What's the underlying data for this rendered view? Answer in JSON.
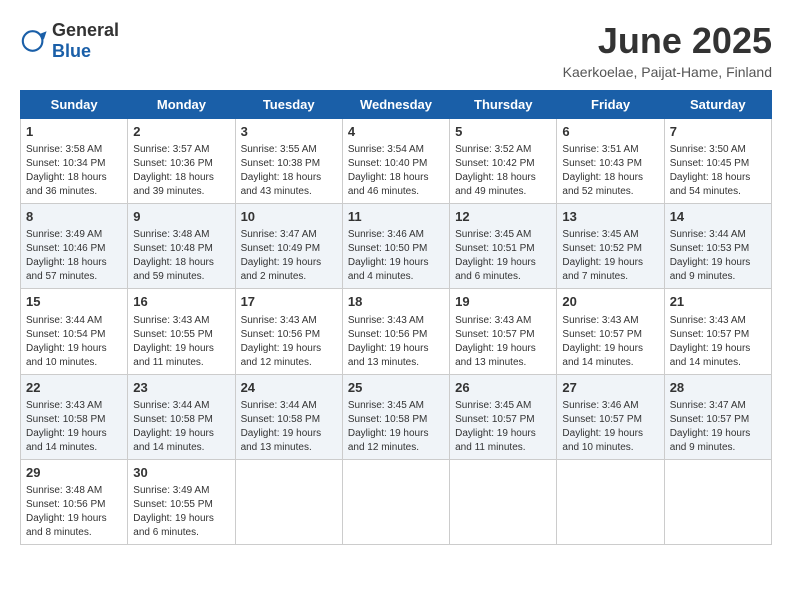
{
  "header": {
    "logo_general": "General",
    "logo_blue": "Blue",
    "month": "June 2025",
    "location": "Kaerkoelae, Paijat-Hame, Finland"
  },
  "days_of_week": [
    "Sunday",
    "Monday",
    "Tuesday",
    "Wednesday",
    "Thursday",
    "Friday",
    "Saturday"
  ],
  "weeks": [
    [
      {
        "day": "1",
        "sunrise": "3:58 AM",
        "sunset": "10:34 PM",
        "daylight": "18 hours and 36 minutes."
      },
      {
        "day": "2",
        "sunrise": "3:57 AM",
        "sunset": "10:36 PM",
        "daylight": "18 hours and 39 minutes."
      },
      {
        "day": "3",
        "sunrise": "3:55 AM",
        "sunset": "10:38 PM",
        "daylight": "18 hours and 43 minutes."
      },
      {
        "day": "4",
        "sunrise": "3:54 AM",
        "sunset": "10:40 PM",
        "daylight": "18 hours and 46 minutes."
      },
      {
        "day": "5",
        "sunrise": "3:52 AM",
        "sunset": "10:42 PM",
        "daylight": "18 hours and 49 minutes."
      },
      {
        "day": "6",
        "sunrise": "3:51 AM",
        "sunset": "10:43 PM",
        "daylight": "18 hours and 52 minutes."
      },
      {
        "day": "7",
        "sunrise": "3:50 AM",
        "sunset": "10:45 PM",
        "daylight": "18 hours and 54 minutes."
      }
    ],
    [
      {
        "day": "8",
        "sunrise": "3:49 AM",
        "sunset": "10:46 PM",
        "daylight": "18 hours and 57 minutes."
      },
      {
        "day": "9",
        "sunrise": "3:48 AM",
        "sunset": "10:48 PM",
        "daylight": "18 hours and 59 minutes."
      },
      {
        "day": "10",
        "sunrise": "3:47 AM",
        "sunset": "10:49 PM",
        "daylight": "19 hours and 2 minutes."
      },
      {
        "day": "11",
        "sunrise": "3:46 AM",
        "sunset": "10:50 PM",
        "daylight": "19 hours and 4 minutes."
      },
      {
        "day": "12",
        "sunrise": "3:45 AM",
        "sunset": "10:51 PM",
        "daylight": "19 hours and 6 minutes."
      },
      {
        "day": "13",
        "sunrise": "3:45 AM",
        "sunset": "10:52 PM",
        "daylight": "19 hours and 7 minutes."
      },
      {
        "day": "14",
        "sunrise": "3:44 AM",
        "sunset": "10:53 PM",
        "daylight": "19 hours and 9 minutes."
      }
    ],
    [
      {
        "day": "15",
        "sunrise": "3:44 AM",
        "sunset": "10:54 PM",
        "daylight": "19 hours and 10 minutes."
      },
      {
        "day": "16",
        "sunrise": "3:43 AM",
        "sunset": "10:55 PM",
        "daylight": "19 hours and 11 minutes."
      },
      {
        "day": "17",
        "sunrise": "3:43 AM",
        "sunset": "10:56 PM",
        "daylight": "19 hours and 12 minutes."
      },
      {
        "day": "18",
        "sunrise": "3:43 AM",
        "sunset": "10:56 PM",
        "daylight": "19 hours and 13 minutes."
      },
      {
        "day": "19",
        "sunrise": "3:43 AM",
        "sunset": "10:57 PM",
        "daylight": "19 hours and 13 minutes."
      },
      {
        "day": "20",
        "sunrise": "3:43 AM",
        "sunset": "10:57 PM",
        "daylight": "19 hours and 14 minutes."
      },
      {
        "day": "21",
        "sunrise": "3:43 AM",
        "sunset": "10:57 PM",
        "daylight": "19 hours and 14 minutes."
      }
    ],
    [
      {
        "day": "22",
        "sunrise": "3:43 AM",
        "sunset": "10:58 PM",
        "daylight": "19 hours and 14 minutes."
      },
      {
        "day": "23",
        "sunrise": "3:44 AM",
        "sunset": "10:58 PM",
        "daylight": "19 hours and 14 minutes."
      },
      {
        "day": "24",
        "sunrise": "3:44 AM",
        "sunset": "10:58 PM",
        "daylight": "19 hours and 13 minutes."
      },
      {
        "day": "25",
        "sunrise": "3:45 AM",
        "sunset": "10:58 PM",
        "daylight": "19 hours and 12 minutes."
      },
      {
        "day": "26",
        "sunrise": "3:45 AM",
        "sunset": "10:57 PM",
        "daylight": "19 hours and 11 minutes."
      },
      {
        "day": "27",
        "sunrise": "3:46 AM",
        "sunset": "10:57 PM",
        "daylight": "19 hours and 10 minutes."
      },
      {
        "day": "28",
        "sunrise": "3:47 AM",
        "sunset": "10:57 PM",
        "daylight": "19 hours and 9 minutes."
      }
    ],
    [
      {
        "day": "29",
        "sunrise": "3:48 AM",
        "sunset": "10:56 PM",
        "daylight": "19 hours and 8 minutes."
      },
      {
        "day": "30",
        "sunrise": "3:49 AM",
        "sunset": "10:55 PM",
        "daylight": "19 hours and 6 minutes."
      },
      null,
      null,
      null,
      null,
      null
    ]
  ]
}
